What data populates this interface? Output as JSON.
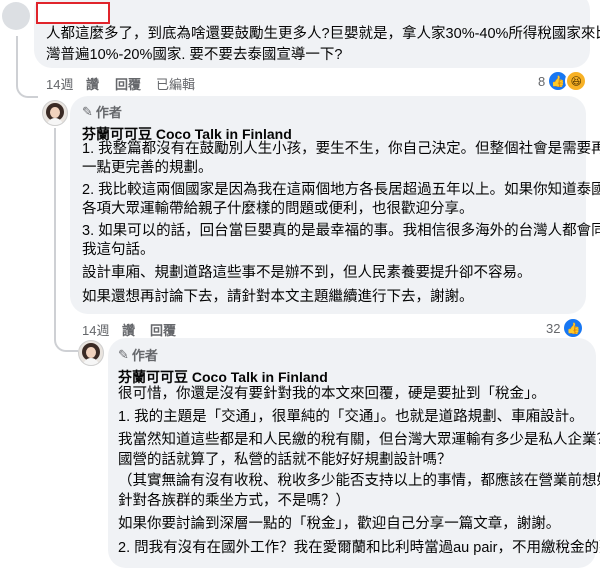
{
  "comment1": {
    "text_lines": [
      "人都這麼多了，到底為啥還要鼓勵生更多人?巨嬰就是，拿人家30%-40%所得稅國家來比台",
      "灣普遍10%-20%國家. 要不要去泰國宣導一下?"
    ],
    "time": "14週",
    "like_label": "讚",
    "reply_label": "回覆",
    "edited_label": "已編輯",
    "reaction_count": "8",
    "reactions": [
      "like-icon",
      "haha-icon"
    ]
  },
  "comment2": {
    "author_badge": "作者",
    "author_name": "芬蘭可可豆 Coco Talk in Finland",
    "paragraphs": [
      [
        "1. 我整篇都沒有在鼓勵別人生小孩，要生不生，你自己決定。但整個社會是需要再多",
        "一點更完善的規劃。"
      ],
      [
        "2. 我比較這兩個國家是因為我在這兩個地方各長居超過五年以上。如果你知道泰國的",
        "各項大眾運輸帶給親子什麼樣的問題或便利，也很歡迎分享。"
      ],
      [
        "3. 如果可以的話，回台當巨嬰真的是最幸福的事。我相信很多海外的台灣人都會同意",
        "我這句話。"
      ],
      [
        "設計車廂、規劃道路這些事不是辦不到，但人民素養要提升卻不容易。"
      ],
      [
        "如果還想再討論下去，請針對本文主題繼續進行下去，謝謝。"
      ]
    ],
    "time": "14週",
    "like_label": "讚",
    "reply_label": "回覆",
    "reaction_count": "32",
    "reactions": [
      "like-icon"
    ]
  },
  "comment3": {
    "author_badge": "作者",
    "author_name": "芬蘭可可豆 Coco Talk in Finland",
    "lines": [
      "很可惜，你還是沒有要針對我的本文來回覆，硬是要扯到「稅金」。",
      "",
      "1. 我的主題是「交通」，很單純的「交通」。也就是道路規劃、車廂設計。",
      "",
      "我當然知道這些都是和人民繳的稅有關，但台灣大眾運輸有多少是私人企業？",
      "國營的話就算了，私營的話就不能好好規劃設計嗎？",
      "",
      "（其實無論有沒有收稅、稅收多少能否支持以上的事情，都應該在營業前想好",
      "針對各族群的乘坐方式，不是嗎？）",
      "",
      "如果你要討論到深層一點的「稅金」，歡迎自己分享一篇文章，謝謝。",
      "",
      "2. 問我有沒有在國外工作？我在愛爾蘭和比利時當過au pair，不用繳稅金的那"
    ]
  }
}
